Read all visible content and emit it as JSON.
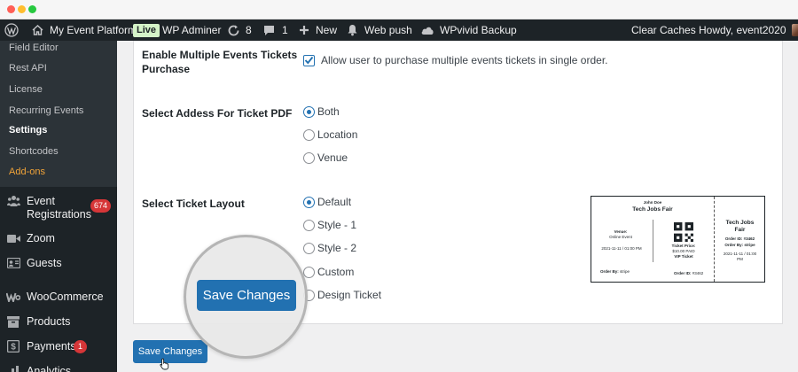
{
  "window": {
    "controls": [
      "close",
      "minimize",
      "maximize"
    ]
  },
  "adminbar": {
    "wp_logo_icon": "wordpress-icon",
    "site_name": "My Event Platform",
    "live_badge": "Live",
    "wp_adminer": "WP Adminer",
    "updates_count": "8",
    "comments_count": "1",
    "new_label": "New",
    "web_push": "Web push",
    "backup": "WPvivid Backup",
    "clear_caches": "Clear Caches",
    "howdy": "Howdy, event2020"
  },
  "sidebar": {
    "submenu": [
      {
        "label": "Field Editor",
        "state": "normal"
      },
      {
        "label": "Rest API",
        "state": "normal"
      },
      {
        "label": "License",
        "state": "normal"
      },
      {
        "label": "Recurring Events",
        "state": "normal"
      },
      {
        "label": "Settings",
        "state": "current"
      },
      {
        "label": "Shortcodes",
        "state": "normal"
      },
      {
        "label": "Add-ons",
        "state": "highlight"
      }
    ],
    "menu": [
      {
        "label_line1": "Event",
        "label_line2": "Registrations",
        "badge": "674",
        "icon": "users-icon"
      },
      {
        "label": "Zoom",
        "icon": "video-camera-icon"
      },
      {
        "label": "Guests",
        "icon": "id-card-icon"
      },
      {
        "label": "WooCommerce",
        "icon": "woocommerce-icon"
      },
      {
        "label": "Products",
        "icon": "archive-box-icon"
      },
      {
        "label": "Payments",
        "badge": "1",
        "icon": "dollar-icon"
      },
      {
        "label": "Analytics",
        "icon": "bar-chart-icon"
      }
    ]
  },
  "settings": {
    "multiple_tickets": {
      "label": "Enable Multiple Events Tickets Purchase",
      "checkbox_label": "Allow user to purchase multiple events tickets in single order.",
      "checked": true
    },
    "pdf_address": {
      "label": "Select Addess For Ticket PDF",
      "options": [
        "Both",
        "Location",
        "Venue"
      ],
      "selected": "Both"
    },
    "ticket_layout": {
      "label": "Select Ticket Layout",
      "options": [
        "Default",
        "Style - 1",
        "Style - 2",
        "Custom",
        "Design Ticket"
      ],
      "selected": "Default"
    }
  },
  "ticket_preview": {
    "attendee": "John Doe",
    "event": "Tech Jobs Fair",
    "venue_label": "Venue:",
    "venue": "Online Event",
    "date": "2021-11-11 / 01:00 PM",
    "price_label": "Ticket Price:",
    "price": "$10.00 PAID",
    "ticket_type": "VIP Ticket",
    "order_by_label": "Order By:",
    "order_by": "stripe",
    "order_id_label": "Order ID:",
    "order_id": "#3462",
    "stub_event_line1": "Tech Jobs",
    "stub_event_line2": "Fair",
    "stub_order_id": "Order ID: #3462",
    "stub_order_by": "Order By: stripe",
    "stub_date_line1": "2021-11-11 / 01:00",
    "stub_date_line2": "PM"
  },
  "buttons": {
    "save_zoomed": "Save Changes",
    "save_bottom": "Save Changes"
  },
  "colors": {
    "admin_bar": "#1d2327",
    "primary": "#2271b1",
    "badge_red": "#d63638",
    "addon_orange": "#f0a338"
  }
}
